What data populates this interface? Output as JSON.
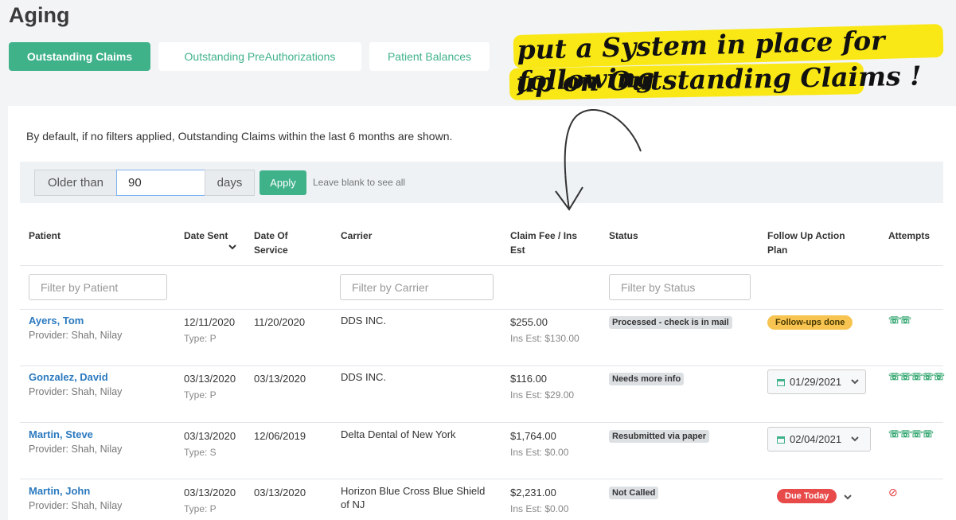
{
  "page": {
    "title": "Aging"
  },
  "tabs": [
    {
      "label": "Outstanding Claims"
    },
    {
      "label": "Outstanding PreAuthorizations"
    },
    {
      "label": "Patient Balances"
    }
  ],
  "notice": "By default, if no filters applied, Outstanding Claims within the last 6 months are shown.",
  "filter": {
    "prefix": "Older than",
    "value": "90",
    "suffix": "days",
    "apply_label": "Apply",
    "hint": "Leave blank to see all"
  },
  "table": {
    "headers": {
      "patient": "Patient",
      "date_sent": "Date Sent",
      "dos_line1": "Date Of",
      "dos_line2": "Service",
      "carrier": "Carrier",
      "fee_line1": "Claim Fee / Ins",
      "fee_line2": "Est",
      "status": "Status",
      "plan_line1": "Follow Up Action",
      "plan_line2": "Plan",
      "attempts": "Attempts"
    },
    "filters": {
      "patient_placeholder": "Filter by Patient",
      "carrier_placeholder": "Filter by Carrier",
      "status_placeholder": "Filter by Status"
    },
    "rows": [
      {
        "patient": "Ayers, Tom",
        "provider": "Provider: Shah, Nilay",
        "date_sent": "12/11/2020",
        "type": "Type:  P",
        "dos": "11/20/2020",
        "carrier": "DDS INC.",
        "carrier_line2": "",
        "fee": "$255.00",
        "ins_est": "Ins Est:  $130.00",
        "status": "Processed - check is in mail",
        "plan": "Follow-ups done",
        "attempts": "☏☏"
      },
      {
        "patient": "Gonzalez, David",
        "provider": "Provider: Shah, Nilay",
        "date_sent": "03/13/2020",
        "type": "Type:  P",
        "dos": "03/13/2020",
        "carrier": "DDS INC.",
        "carrier_line2": "",
        "fee": "$116.00",
        "ins_est": "Ins Est:  $29.00",
        "status": "Needs more info",
        "plan": "01/29/2021",
        "attempts": "☏☏☏☏☏"
      },
      {
        "patient": "Martin, Steve",
        "provider": "Provider: Shah, Nilay",
        "date_sent": "03/13/2020",
        "type": "Type:  S",
        "dos": "12/06/2019",
        "carrier": "Delta Dental of New York",
        "carrier_line2": "",
        "fee": "$1,764.00",
        "ins_est": "Ins Est:  $0.00",
        "status": "Resubmitted via paper",
        "plan": "02/04/2021",
        "attempts": "☏☏☏☏"
      },
      {
        "patient": "Martin, John",
        "provider": "Provider: Shah, Nilay",
        "date_sent": "03/13/2020",
        "type": "Type:  P",
        "dos": "03/13/2020",
        "carrier": "Horizon Blue Cross Blue Shield",
        "carrier_line2": "of NJ",
        "fee": "$2,231.00",
        "ins_est": "Ins Est:  $0.00",
        "status": "Not Called",
        "plan": "Due Today",
        "attempts": ""
      }
    ]
  },
  "annotation": {
    "line1": "put a System in place for following",
    "line2": "up on Outstanding Claims !"
  },
  "colors": {
    "brand_green": "#3fb28a",
    "link_blue": "#2b79bf",
    "highlight_yellow": "#f9e816",
    "followups_done": "#f7c451",
    "due_today": "#e84a4a"
  },
  "icons": {
    "sort": "chevron-down-icon",
    "calendar": "calendar-icon",
    "attempt": "phone-icon",
    "no_attempt": "ban-icon"
  }
}
